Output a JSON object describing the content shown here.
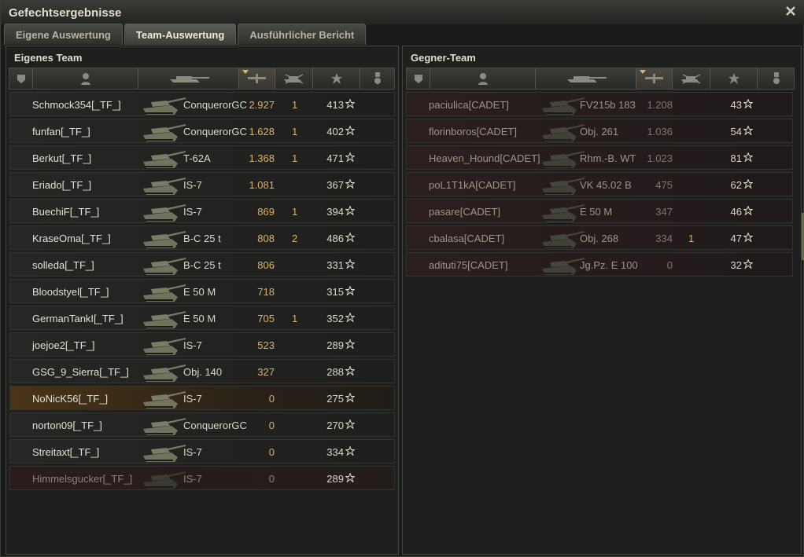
{
  "window": {
    "title": "Gefechtsergebnisse"
  },
  "tabs": [
    {
      "label": "Eigene Auswertung"
    },
    {
      "label": "Team-Auswertung"
    },
    {
      "label": "Ausführlicher Bericht"
    }
  ],
  "own_team": {
    "title": "Eigenes Team",
    "players": [
      {
        "name": "Schmock354[_TF_]",
        "tank": "ConquerorGC",
        "damage": "2.927",
        "kills": "1",
        "xp": "413"
      },
      {
        "name": "funfan[_TF_]",
        "tank": "ConquerorGC",
        "damage": "1.628",
        "kills": "1",
        "xp": "402"
      },
      {
        "name": "Berkut[_TF_]",
        "tank": "T-62A",
        "damage": "1.368",
        "kills": "1",
        "xp": "471"
      },
      {
        "name": "Eriado[_TF_]",
        "tank": "IS-7",
        "damage": "1.081",
        "kills": "",
        "xp": "367"
      },
      {
        "name": "BuechiF[_TF_]",
        "tank": "IS-7",
        "damage": "869",
        "kills": "1",
        "xp": "394"
      },
      {
        "name": "KraseOma[_TF_]",
        "tank": "B-C 25 t",
        "damage": "808",
        "kills": "2",
        "xp": "486"
      },
      {
        "name": "solleda[_TF_]",
        "tank": "B-C 25 t",
        "damage": "806",
        "kills": "",
        "xp": "331"
      },
      {
        "name": "Bloodstyel[_TF_]",
        "tank": "E 50 M",
        "damage": "718",
        "kills": "",
        "xp": "315"
      },
      {
        "name": "GermanTankI[_TF_]",
        "tank": "E 50 M",
        "damage": "705",
        "kills": "1",
        "xp": "352"
      },
      {
        "name": "joejoe2[_TF_]",
        "tank": "IS-7",
        "damage": "523",
        "kills": "",
        "xp": "289"
      },
      {
        "name": "GSG_9_Sierra[_TF_]",
        "tank": "Obj. 140",
        "damage": "327",
        "kills": "",
        "xp": "288"
      },
      {
        "name": "NoNicK56[_TF_]",
        "tank": "IS-7",
        "damage": "0",
        "kills": "",
        "xp": "275"
      },
      {
        "name": "norton09[_TF_]",
        "tank": "ConquerorGC",
        "damage": "0",
        "kills": "",
        "xp": "270"
      },
      {
        "name": "Streitaxt[_TF_]",
        "tank": "IS-7",
        "damage": "0",
        "kills": "",
        "xp": "334"
      },
      {
        "name": "Himmelsgucker[_TF_]",
        "tank": "IS-7",
        "damage": "0",
        "kills": "",
        "xp": "289"
      }
    ]
  },
  "enemy_team": {
    "title": "Gegner-Team",
    "players": [
      {
        "name": "paciulica[CADET]",
        "tank": "FV215b 183",
        "damage": "1.208",
        "kills": "",
        "xp": "43"
      },
      {
        "name": "florinboros[CADET]",
        "tank": "Obj. 261",
        "damage": "1.036",
        "kills": "",
        "xp": "54"
      },
      {
        "name": "Heaven_Hound[CADET]",
        "tank": "Rhm.-B. WT",
        "damage": "1.023",
        "kills": "",
        "xp": "81"
      },
      {
        "name": "poL1T1kA[CADET]",
        "tank": "VK 45.02 B",
        "damage": "475",
        "kills": "",
        "xp": "62"
      },
      {
        "name": "pasare[CADET]",
        "tank": "E 50 M",
        "damage": "347",
        "kills": "",
        "xp": "46"
      },
      {
        "name": "cbalasa[CADET]",
        "tank": "Obj. 268",
        "damage": "334",
        "kills": "1",
        "xp": "47"
      },
      {
        "name": "adituti75[CADET]",
        "tank": "Jg.Pz. E 100",
        "damage": "0",
        "kills": "",
        "xp": "32"
      }
    ]
  }
}
